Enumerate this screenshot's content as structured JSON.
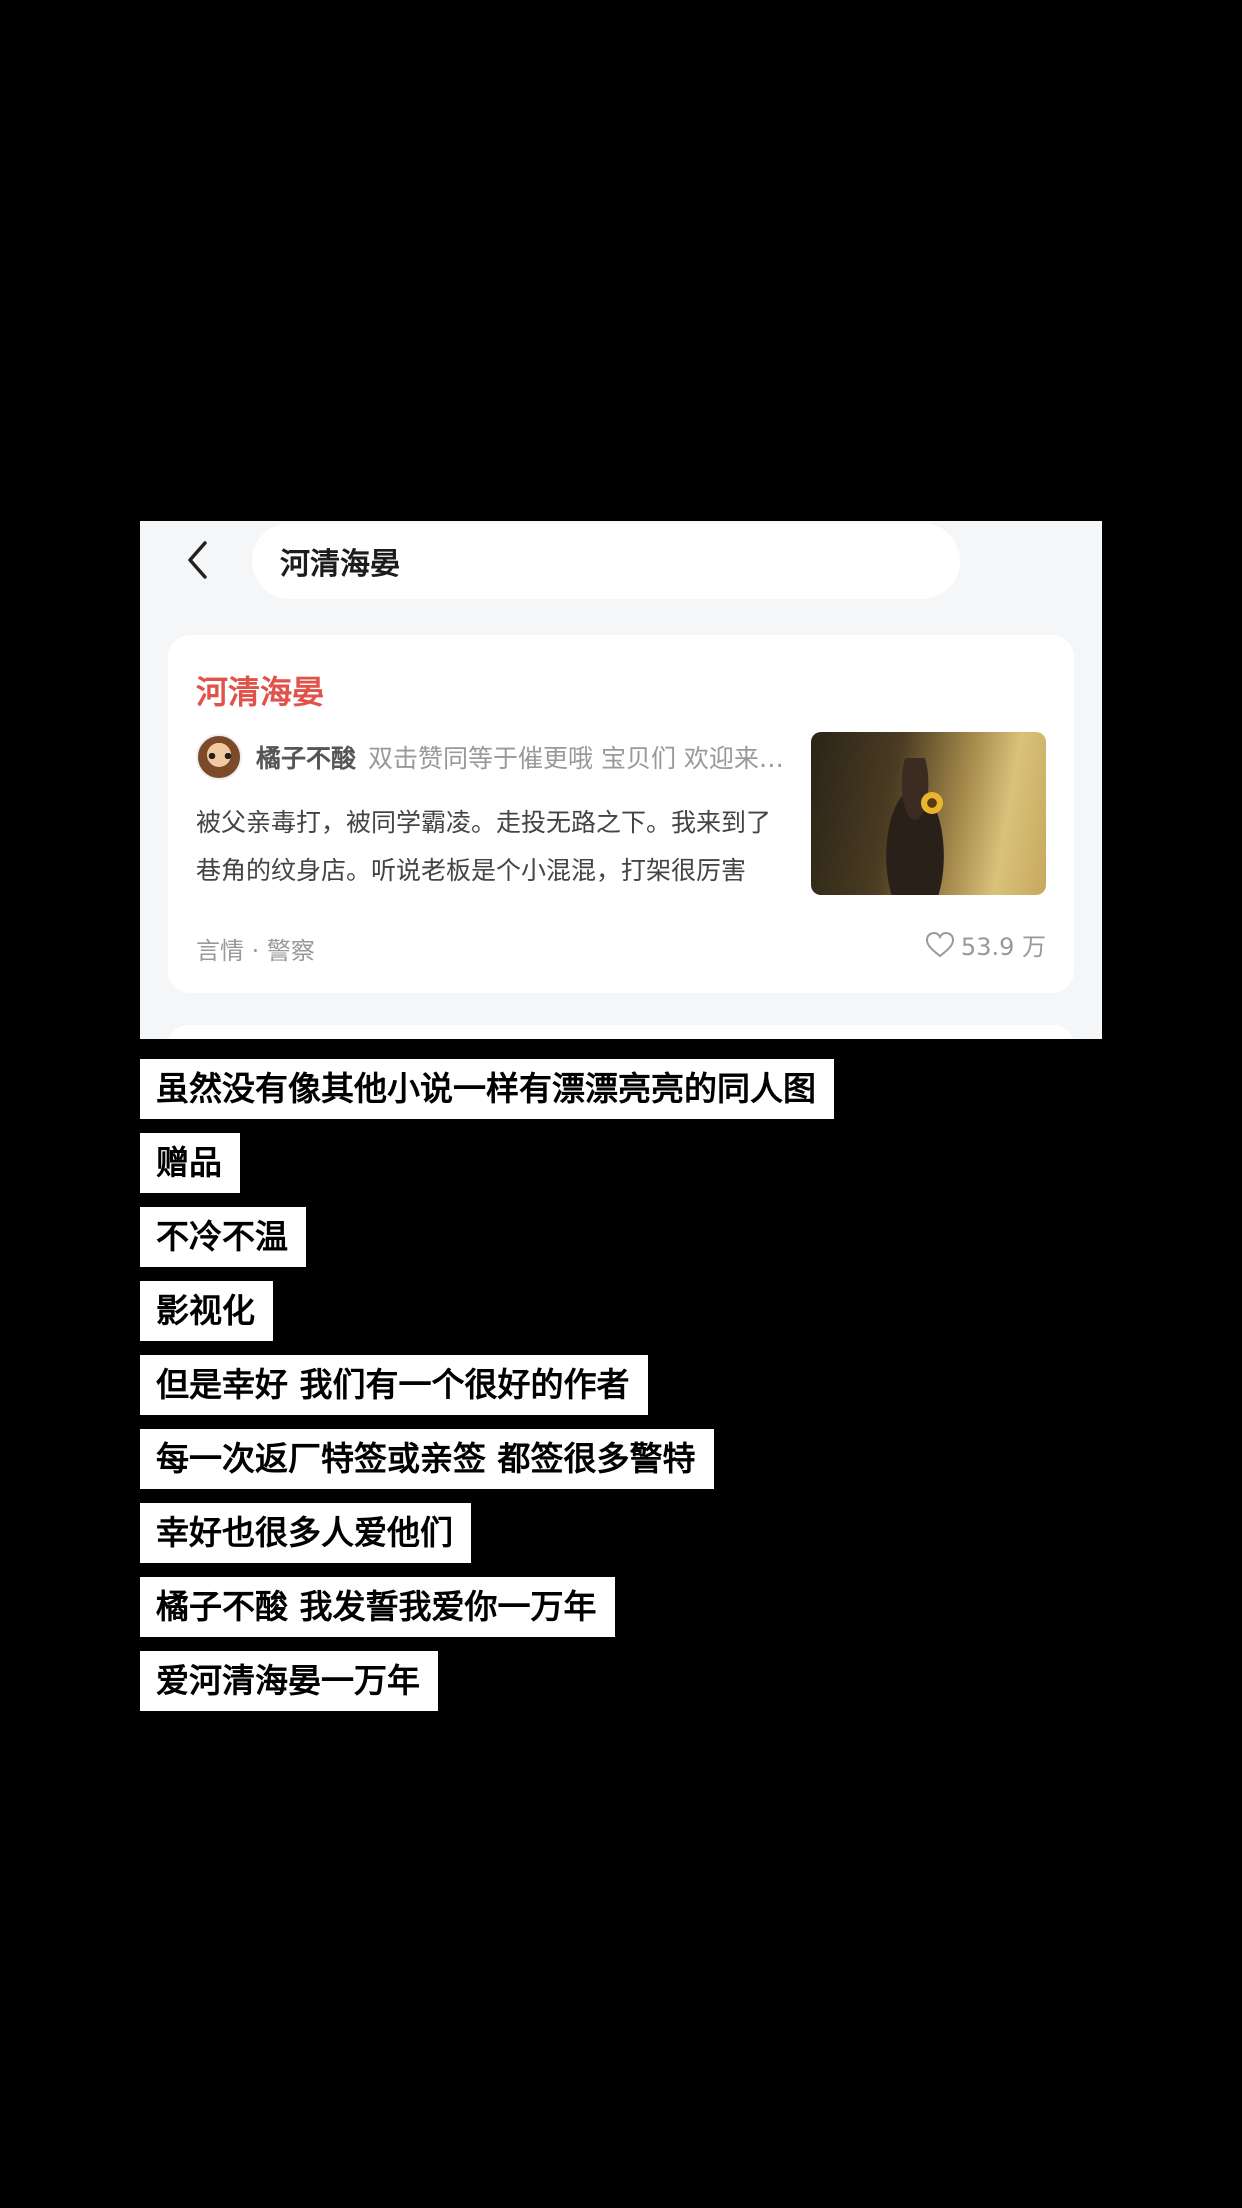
{
  "search": {
    "query": "河清海晏"
  },
  "result": {
    "title": "河清海晏",
    "author": "橘子不酸",
    "author_note": "双击赞同等于催更哦 宝贝们 欢迎来看我的其他小说",
    "summary": "被父亲毒打，被同学霸凌。走投无路之下。我来到了巷角的纹身店。听说老板是个小混混，打架很厉害",
    "tags": "言情 · 警察",
    "likes": "53.9 万"
  },
  "captions": [
    "虽然没有像其他小说一样有漂漂亮亮的同人图",
    "赠品",
    "不冷不温",
    "影视化",
    "但是幸好 我们有一个很好的作者",
    "每一次返厂特签或亲签 都签很多警特",
    "幸好也很多人爱他们",
    "橘子不酸 我发誓我爱你一万年",
    "爱河清海晏一万年"
  ],
  "colors": {
    "title_accent": "#e1524a",
    "background": "#000000"
  },
  "icons": {
    "back": "chevron-left-icon",
    "like": "heart-outline-icon"
  }
}
